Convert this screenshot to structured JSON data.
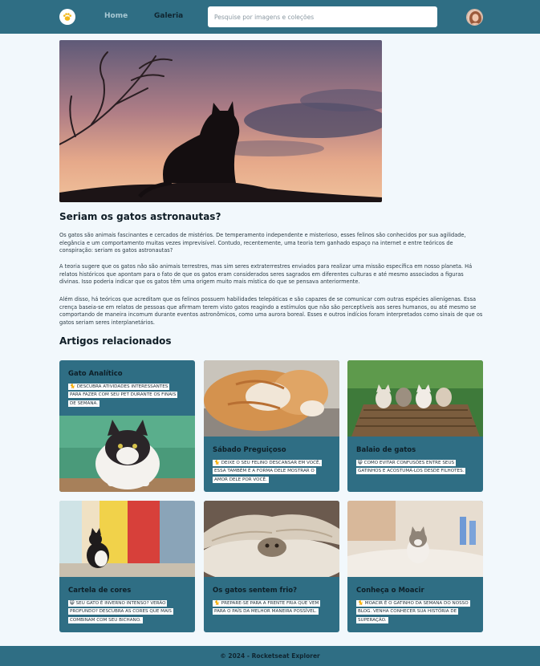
{
  "header": {
    "nav_home": "Home",
    "nav_gallery": "Galeria",
    "search_placeholder": "Pesquise por imagens e coleções"
  },
  "article": {
    "title": "Seriam os gatos astronautas?",
    "paragraphs": [
      "Os gatos são animais fascinantes e cercados de mistérios. De temperamento independente e misterioso, esses felinos são conhecidos por sua agilidade, elegância e um comportamento muitas vezes imprevisível. Contudo, recentemente, uma teoria tem ganhado espaço na internet e entre teóricos de conspiração: seriam os gatos astronautas?",
      "A teoria sugere que os gatos não são animais terrestres, mas sim seres extraterrestres enviados para realizar uma missão específica em nosso planeta. Há relatos históricos que apontam para o fato de que os gatos eram considerados seres sagrados em diferentes culturas e até mesmo associados a figuras divinas. Isso poderia indicar que os gatos têm uma origem muito mais mística do que se pensava anteriormente.",
      "Além disso, há teóricos que acreditam que os felinos possuem habilidades telepáticas e são capazes de se comunicar com outras espécies alienígenas. Essa crença baseia-se em relatos de pessoas que afirmam terem visto gatos reagindo a estímulos que não são perceptíveis aos seres humanos, ou até mesmo se comportando de maneira incomum durante eventos astronômicos, como uma aurora boreal. Esses e outros indícios foram interpretados como sinais de que os gatos seriam seres interplanetários."
    ]
  },
  "related": {
    "title": "Artigos relacionados",
    "cards": [
      {
        "title": "Gato Analítico",
        "desc": "🐈 Descubra atividades interessantes para fazer com seu pet durante os finais de semana."
      },
      {
        "title": "Sábado Preguiçoso",
        "desc": "🐈 Deixe o seu felino descansar em você, essa também é a forma dele mostrar o amor dele por você."
      },
      {
        "title": "Balaio de gatos",
        "desc": "😸 Como evitar confusões entre seus gatinhos e acostumá-los desde filhotes."
      },
      {
        "title": "Cartela de cores",
        "desc": "😸 Seu gato é inverno intenso? Verão profundo? Descubra as cores que mais combinam com seu bichano."
      },
      {
        "title": "Os gatos sentem frio?",
        "desc": "🐈 Prepare-se para a frente fria que vem para o país da melhor maneira possível."
      },
      {
        "title": "Conheça o Moacir",
        "desc": "🐈 Moacir é o gatinho da semana do nosso blog. Venha conhecer sua história de superação."
      }
    ]
  },
  "footer": {
    "text": "© 2024 - Rocketseat Explorer"
  },
  "colors": {
    "primary": "#2f6e84",
    "background": "#f2f8fc",
    "text": "#0f1d26"
  }
}
